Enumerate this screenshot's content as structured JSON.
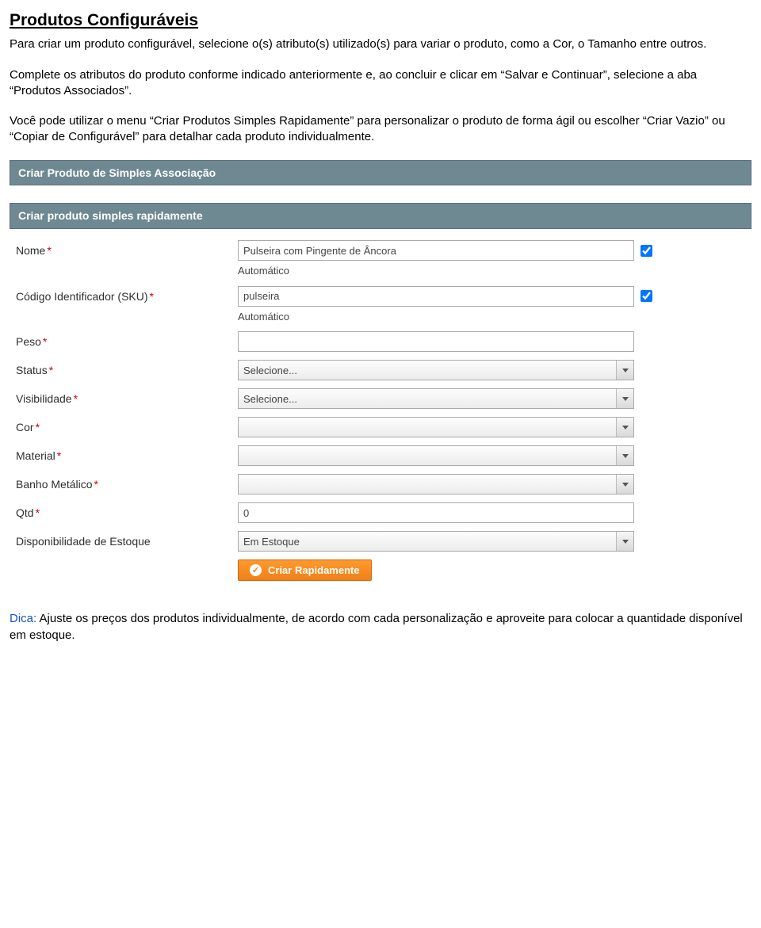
{
  "doc": {
    "title": "Produtos Configuráveis",
    "p1": "Para criar um produto configurável, selecione o(s) atributo(s) utilizado(s) para variar o produto, como a Cor, o Tamanho entre outros.",
    "p2": "Complete os atributos do produto conforme indicado anteriormente e, ao concluir e clicar em “Salvar e Continuar”, selecione a aba “Produtos Associados”.",
    "p3": "Você pode utilizar o menu “Criar Produtos Simples Rapidamente” para personalizar o produto de forma ágil ou escolher “Criar Vazio” ou “Copiar de Configurável” para detalhar cada produto individualmente.",
    "tip_label": "Dica:",
    "tip_text": " Ajuste os preços dos produtos individualmente, de acordo com cada personalização e aproveite para colocar a quantidade disponível em estoque."
  },
  "panels": {
    "assoc_header": "Criar Produto de Simples Associação",
    "quick_header": "Criar produto simples rapidamente"
  },
  "form": {
    "labels": {
      "nome": "Nome",
      "sku": "Código Identificador (SKU)",
      "peso": "Peso",
      "status": "Status",
      "visibilidade": "Visibilidade",
      "cor": "Cor",
      "material": "Material",
      "banho": "Banho Metálico",
      "qtd": "Qtd",
      "disp": "Disponibilidade de Estoque"
    },
    "req": "*",
    "auto": "Automático",
    "values": {
      "nome": "Pulseira com Pingente de Âncora",
      "sku": "pulseira",
      "peso": "",
      "status": "Selecione...",
      "visibilidade": "Selecione...",
      "cor": "",
      "material": "",
      "banho": "",
      "qtd": "0",
      "disp": "Em Estoque"
    },
    "nome_auto_checked": true,
    "sku_auto_checked": true,
    "button": "Criar Rapidamente"
  }
}
